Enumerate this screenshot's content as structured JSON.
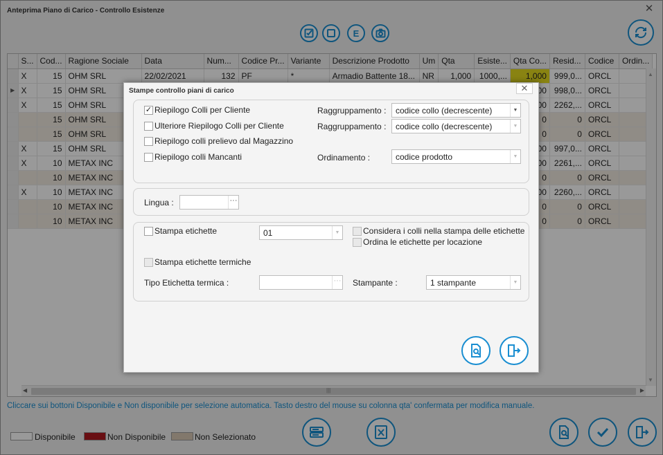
{
  "window": {
    "title": "Anteprima Piano di Carico - Controllo Esistenze",
    "close_label": "✕"
  },
  "toolbar": {
    "check_all": "☑",
    "uncheck_all": "☐",
    "excel": "E",
    "camera": "📷"
  },
  "grid": {
    "columns": [
      "S...",
      "Cod...",
      "Ragione Sociale",
      "Data",
      "Num...",
      "Codice Pr...",
      "Variante",
      "Descrizione Prodotto",
      "Um",
      "Qta",
      "Esiste...",
      "Qta Co...",
      "Resid...",
      "Codice",
      "Ordin..."
    ],
    "rows": [
      {
        "s": "X",
        "cod": "15",
        "rag": "OHM SRL",
        "data": "22/02/2021",
        "num": "132",
        "cp": "PF",
        "var": "*",
        "desc": "Armadio Battente 18...",
        "um": "NR",
        "qta": "1,000",
        "esi": "1000,...",
        "qco": "1,000",
        "res": "999,0...",
        "codice": "ORCL",
        "ord": "",
        "tan": false,
        "yellow": true,
        "indicator": ""
      },
      {
        "s": "X",
        "cod": "15",
        "rag": "OHM SRL",
        "data": "",
        "num": "",
        "cp": "",
        "var": "",
        "desc": "",
        "um": "",
        "qta": "",
        "esi": "",
        "qco": "00",
        "res": "998,0...",
        "codice": "ORCL",
        "ord": "",
        "tan": false,
        "yellow": false,
        "indicator": "▶"
      },
      {
        "s": "X",
        "cod": "15",
        "rag": "OHM SRL",
        "data": "",
        "num": "",
        "cp": "",
        "var": "",
        "desc": "",
        "um": "",
        "qta": "",
        "esi": "",
        "qco": "00",
        "res": "2262,...",
        "codice": "ORCL",
        "ord": "",
        "tan": false,
        "yellow": false,
        "indicator": ""
      },
      {
        "s": "",
        "cod": "15",
        "rag": "OHM SRL",
        "data": "",
        "num": "",
        "cp": "",
        "var": "",
        "desc": "",
        "um": "",
        "qta": "",
        "esi": "",
        "qco": "0",
        "res": "0",
        "codice": "ORCL",
        "ord": "",
        "tan": true,
        "yellow": false,
        "indicator": ""
      },
      {
        "s": "",
        "cod": "15",
        "rag": "OHM SRL",
        "data": "",
        "num": "",
        "cp": "",
        "var": "",
        "desc": "",
        "um": "",
        "qta": "",
        "esi": "",
        "qco": "0",
        "res": "0",
        "codice": "ORCL",
        "ord": "",
        "tan": true,
        "yellow": false,
        "indicator": ""
      },
      {
        "s": "X",
        "cod": "15",
        "rag": "OHM SRL",
        "data": "",
        "num": "",
        "cp": "",
        "var": "",
        "desc": "",
        "um": "",
        "qta": "",
        "esi": "",
        "qco": "00",
        "res": "997,0...",
        "codice": "ORCL",
        "ord": "",
        "tan": false,
        "yellow": false,
        "indicator": ""
      },
      {
        "s": "X",
        "cod": "10",
        "rag": "METAX INC",
        "data": "",
        "num": "",
        "cp": "",
        "var": "",
        "desc": "",
        "um": "",
        "qta": "",
        "esi": "",
        "qco": "00",
        "res": "2261,...",
        "codice": "ORCL",
        "ord": "",
        "tan": false,
        "yellow": false,
        "indicator": ""
      },
      {
        "s": "",
        "cod": "10",
        "rag": "METAX INC",
        "data": "",
        "num": "",
        "cp": "",
        "var": "",
        "desc": "",
        "um": "",
        "qta": "",
        "esi": "",
        "qco": "0",
        "res": "0",
        "codice": "ORCL",
        "ord": "",
        "tan": true,
        "yellow": false,
        "indicator": ""
      },
      {
        "s": "X",
        "cod": "10",
        "rag": "METAX INC",
        "data": "",
        "num": "",
        "cp": "",
        "var": "",
        "desc": "",
        "um": "",
        "qta": "",
        "esi": "",
        "qco": "00",
        "res": "2260,...",
        "codice": "ORCL",
        "ord": "",
        "tan": false,
        "yellow": false,
        "indicator": ""
      },
      {
        "s": "",
        "cod": "10",
        "rag": "METAX INC",
        "data": "",
        "num": "",
        "cp": "",
        "var": "",
        "desc": "",
        "um": "",
        "qta": "",
        "esi": "",
        "qco": "0",
        "res": "0",
        "codice": "ORCL",
        "ord": "",
        "tan": true,
        "yellow": false,
        "indicator": ""
      },
      {
        "s": "",
        "cod": "10",
        "rag": "METAX INC",
        "data": "",
        "num": "",
        "cp": "",
        "var": "",
        "desc": "",
        "um": "",
        "qta": "",
        "esi": "",
        "qco": "0",
        "res": "0",
        "codice": "ORCL",
        "ord": "",
        "tan": true,
        "yellow": false,
        "indicator": ""
      }
    ]
  },
  "hint": "Cliccare sui bottoni Disponibile e Non disponibile per selezione automatica. Tasto destro del mouse su colonna qta' confermata per modifica manuale.",
  "legend": {
    "available": {
      "label": "Disponibile",
      "color": "#ffffff"
    },
    "unavailable": {
      "label": "Non Disponibile",
      "color": "#b01a20"
    },
    "not_selected": {
      "label": "Non Selezionato",
      "color": "#d9c9b5"
    }
  },
  "colors": {
    "accent": "#1a8ed1",
    "row_tan": "#f1e9df",
    "yellow_cell": "#e5da1e"
  },
  "dialog": {
    "title": "Stampe controllo piani di carico",
    "close_label": "✕",
    "group1": {
      "riepilogo_cliente": {
        "label": "Riepilogo Colli per Cliente",
        "checked": true,
        "mark": "✓"
      },
      "ulteriore": {
        "label": "Ulteriore Riepilogo Colli per Cliente",
        "checked": false
      },
      "prelievo": {
        "label": "Riepilogo colli prelievo dal Magazzino",
        "checked": false
      },
      "mancanti": {
        "label": "Riepilogo colli Mancanti",
        "checked": false
      },
      "raggruppamento_label_1": "Raggruppamento :",
      "raggruppamento_value_1": "codice collo (decrescente)",
      "raggruppamento_label_2": "Raggruppamento :",
      "raggruppamento_value_2": "codice collo (decrescente)",
      "ordinamento_label": "Ordinamento :",
      "ordinamento_value": "codice prodotto"
    },
    "group2": {
      "lingua_label": "Lingua :",
      "lingua_value": "",
      "lingua_dots": "···"
    },
    "group3": {
      "stampa_etichette": {
        "label": "Stampa etichette",
        "checked": false
      },
      "etichette_value": "01",
      "considera": {
        "label": "Considera i colli nella stampa delle etichette",
        "checked": false
      },
      "ordina": {
        "label": "Ordina le etichette per locazione",
        "checked": false
      },
      "termiche": {
        "label": "Stampa etichette termiche",
        "checked": false
      },
      "tipo_label": "Tipo Etichetta termica :",
      "tipo_value": "",
      "tipo_dots": "···",
      "stampante_label": "Stampante :",
      "stampante_value": "1 stampante"
    }
  }
}
